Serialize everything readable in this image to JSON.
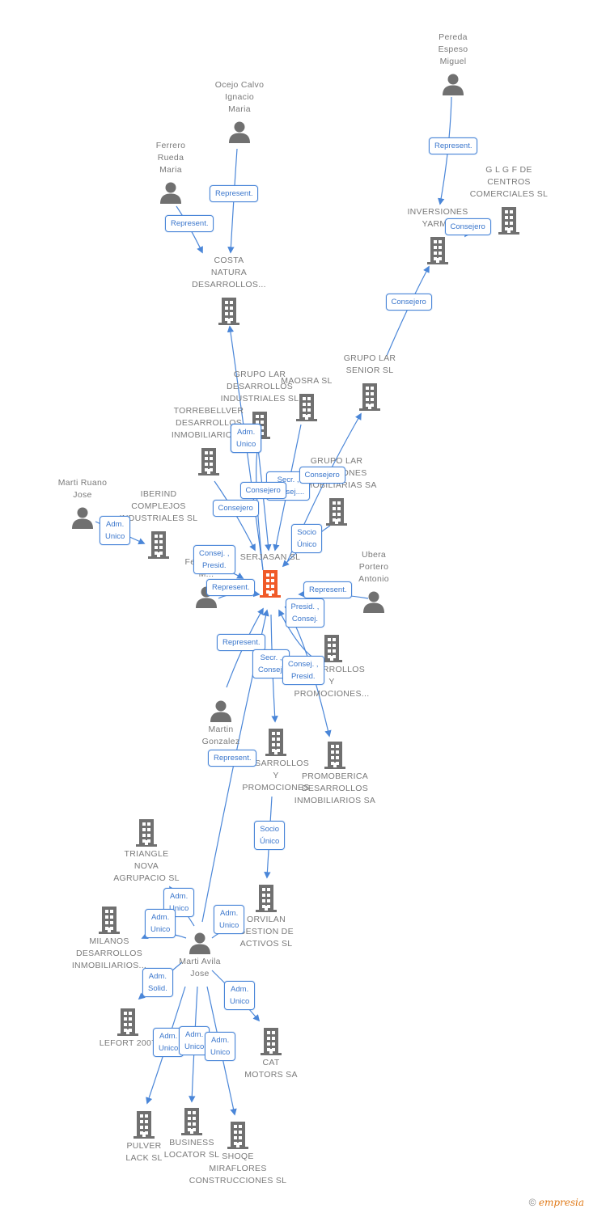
{
  "colors": {
    "node_icon": "#707070",
    "focus_icon": "#f05a28",
    "edge": "#4a86d8",
    "label_text": "#7a7a7a"
  },
  "nodes": [
    {
      "id": "pereda",
      "type": "person",
      "label": "Pereda\nEspeso\nMiguel"
    },
    {
      "id": "ocejo",
      "type": "person",
      "label": "Ocejo Calvo\nIgnacio\nMaria"
    },
    {
      "id": "ferrero",
      "type": "person",
      "label": "Ferrero\nRueda\nMaria"
    },
    {
      "id": "glgf",
      "type": "company",
      "label": "G L G F DE\nCENTROS\nCOMERCIALES SL"
    },
    {
      "id": "yarmu",
      "type": "company",
      "label": "INVERSIONES\nYARMU"
    },
    {
      "id": "costa",
      "type": "company",
      "label": "COSTA\nNATURA\nDESARROLLOS..."
    },
    {
      "id": "larsenior",
      "type": "company",
      "label": "GRUPO LAR\nSENIOR SL"
    },
    {
      "id": "lardes",
      "type": "company",
      "label": "GRUPO LAR\nDESARROLLOS\nINDUSTRIALES SL"
    },
    {
      "id": "maosra",
      "type": "company",
      "label": "MAOSRA  SL"
    },
    {
      "id": "torre",
      "type": "company",
      "label": "TORREBELLVER\nDESARROLLOS\nINMOBILIARIOS..."
    },
    {
      "id": "larinv",
      "type": "company",
      "label": "GRUPO LAR\nINVERSIONES\nINMOBILIARIAS SA"
    },
    {
      "id": "ruano",
      "type": "person",
      "label": "Marti Ruano\nJose"
    },
    {
      "id": "iberind",
      "type": "company",
      "label": "IBERIND\nCOMPLEJOS\nINDUSTRIALES SL"
    },
    {
      "id": "amo",
      "type": "person",
      "label": "Amo\nFernandez\nM..."
    },
    {
      "id": "serjasan",
      "type": "focus",
      "label": "SERJASAN  SL"
    },
    {
      "id": "ubera",
      "type": "person",
      "label": "Ubera\nPortero\nAntonio"
    },
    {
      "id": "desprom1",
      "type": "company",
      "label": "DESARROLLOS\nY\nPROMOCIONES..."
    },
    {
      "id": "martin",
      "type": "person",
      "label": "Martin\nGonzalez"
    },
    {
      "id": "desprom2",
      "type": "company",
      "label": "DESARROLLOS\nY\nPROMOCIONES"
    },
    {
      "id": "promoberica",
      "type": "company",
      "label": "PROMOBERICA\nDESARROLLOS\nINMOBILIARIOS SA"
    },
    {
      "id": "triangle",
      "type": "company",
      "label": "TRIANGLE\nNOVA\nAGRUPACIO SL"
    },
    {
      "id": "orvilan",
      "type": "company",
      "label": "ORVILAN\nGESTION DE\nACTIVOS  SL"
    },
    {
      "id": "milanos",
      "type": "company",
      "label": "MILANOS\nDESARROLLOS\nINMOBILIARIOS..."
    },
    {
      "id": "avila",
      "type": "person",
      "label": "Marti Avila\nJose"
    },
    {
      "id": "lefort",
      "type": "company",
      "label": "LEFORT 2007"
    },
    {
      "id": "cat",
      "type": "company",
      "label": "CAT\nMOTORS SA"
    },
    {
      "id": "pulver",
      "type": "company",
      "label": "PULVER\nLACK SL"
    },
    {
      "id": "business",
      "type": "company",
      "label": "BUSINESS\nLOCATOR SL"
    },
    {
      "id": "shoqe",
      "type": "company",
      "label": "SHOQE\nMIRAFLORES\nCONSTRUCCIONES SL"
    }
  ],
  "edges": [
    {
      "from": "pereda",
      "to": "yarmu",
      "label": "Represent."
    },
    {
      "from": "glgf",
      "to": "yarmu",
      "label": "Consejero"
    },
    {
      "from": "larsenior",
      "to": "yarmu",
      "label": "Consejero"
    },
    {
      "from": "ocejo",
      "to": "costa",
      "label": "Represent."
    },
    {
      "from": "ferrero",
      "to": "costa",
      "label": "Represent."
    },
    {
      "from": "serjasan",
      "to": "costa",
      "label": "Adm.\nUnico"
    },
    {
      "from": "serjasan",
      "to": "lardes",
      "label": "Adm.\nUnico"
    },
    {
      "from": "maosra",
      "to": "serjasan",
      "label": "Secr. ,\nConsej...."
    },
    {
      "from": "lardes",
      "to": "serjasan",
      "label": "Consejero"
    },
    {
      "from": "torre",
      "to": "serjasan",
      "label": "Consejero"
    },
    {
      "from": "serjasan",
      "to": "larsenior",
      "label": "Consejero"
    },
    {
      "from": "larinv",
      "to": "serjasan",
      "label": "Socio\nÚnico"
    },
    {
      "from": "ruano",
      "to": "iberind",
      "label": "Adm.\nUnico"
    },
    {
      "from": "amo",
      "to": "serjasan",
      "label": "Consej. ,\nPresid."
    },
    {
      "from": "amo",
      "to": "serjasan",
      "label": "Represent."
    },
    {
      "from": "ubera",
      "to": "serjasan",
      "label": "Represent."
    },
    {
      "from": "serjasan",
      "to": "promoberica",
      "label": "Presid. ,\nConsej."
    },
    {
      "from": "martin",
      "to": "serjasan",
      "label": "Represent."
    },
    {
      "from": "serjasan",
      "to": "desprom2",
      "label": "Secr. ,\nConsej."
    },
    {
      "from": "desprom1",
      "to": "serjasan",
      "label": "Consej. ,\nPresid."
    },
    {
      "from": "avila",
      "to": "serjasan",
      "label": "Represent."
    },
    {
      "from": "desprom2",
      "to": "orvilan",
      "label": "Socio\nÚnico"
    },
    {
      "from": "avila",
      "to": "triangle",
      "label": "Adm.\nUnico"
    },
    {
      "from": "avila",
      "to": "milanos",
      "label": "Adm.\nUnico"
    },
    {
      "from": "avila",
      "to": "orvilan",
      "label": "Adm.\nUnico"
    },
    {
      "from": "avila",
      "to": "lefort",
      "label": "Adm.\nSolid."
    },
    {
      "from": "avila",
      "to": "cat",
      "label": "Adm.\nUnico"
    },
    {
      "from": "avila",
      "to": "pulver",
      "label": "Adm.\nUnico"
    },
    {
      "from": "avila",
      "to": "business",
      "label": "Adm.\nUnico"
    },
    {
      "from": "avila",
      "to": "shoqe",
      "label": "Adm.\nUnico"
    }
  ],
  "footer": {
    "copyright": "©",
    "brand": "empresia"
  }
}
